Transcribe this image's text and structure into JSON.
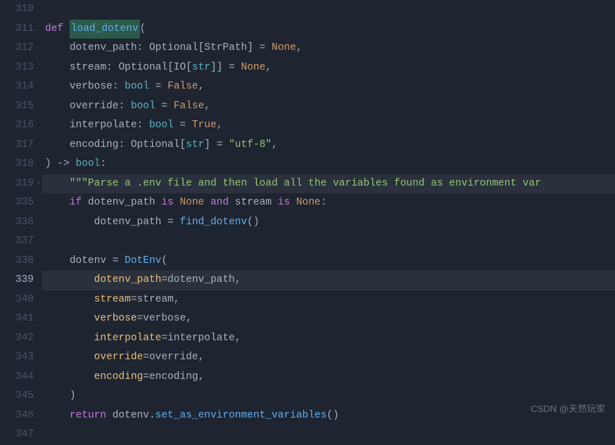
{
  "watermark": "CSDN @天然玩家",
  "gutter": [
    "310",
    "311",
    "312",
    "313",
    "314",
    "315",
    "316",
    "317",
    "318",
    "319",
    "335",
    "336",
    "337",
    "338",
    "339",
    "340",
    "341",
    "342",
    "343",
    "344",
    "345",
    "346",
    "347"
  ],
  "currentLine": "339",
  "foldAt": "319",
  "code": {
    "l311": {
      "def": "def ",
      "fn": "load_dotenv",
      "open": "("
    },
    "l312": {
      "pad": "    ",
      "name": "dotenv_path",
      "colon": ": ",
      "ty": "Optional",
      "br1": "[",
      "ty2": "StrPath",
      "br2": "] ",
      "eq": "= ",
      "val": "None",
      "end": ","
    },
    "l313": {
      "pad": "    ",
      "name": "stream",
      "colon": ": ",
      "ty": "Optional",
      "br1": "[",
      "ty2": "IO",
      "br2": "[",
      "ty3": "str",
      "br3": "]] ",
      "eq": "= ",
      "val": "None",
      "end": ","
    },
    "l314": {
      "pad": "    ",
      "name": "verbose",
      "colon": ": ",
      "ty": "bool",
      "sp": " ",
      "eq": "= ",
      "val": "False",
      "end": ","
    },
    "l315": {
      "pad": "    ",
      "name": "override",
      "colon": ": ",
      "ty": "bool",
      "sp": " ",
      "eq": "= ",
      "val": "False",
      "end": ","
    },
    "l316": {
      "pad": "    ",
      "name": "interpolate",
      "colon": ": ",
      "ty": "bool",
      "sp": " ",
      "eq": "= ",
      "val": "True",
      "end": ","
    },
    "l317": {
      "pad": "    ",
      "name": "encoding",
      "colon": ": ",
      "ty": "Optional",
      "br1": "[",
      "ty2": "str",
      "br2": "] ",
      "eq": "= ",
      "val": "\"utf-8\"",
      "end": ","
    },
    "l318": {
      "close": ") -> ",
      "ty": "bool",
      "colon": ":"
    },
    "l319": {
      "pad": "    ",
      "doc": "\"\"\"Parse a .env file and then load all the variables found as environment var"
    },
    "l335": {
      "pad": "    ",
      "if": "if ",
      "v1": "dotenv_path ",
      "is1": "is ",
      "n1": "None ",
      "and": "and ",
      "v2": "stream ",
      "is2": "is ",
      "n2": "None",
      "colon": ":"
    },
    "l336": {
      "pad": "        ",
      "v": "dotenv_path ",
      "eq": "= ",
      "fn": "find_dotenv",
      "call": "()"
    },
    "l338": {
      "pad": "    ",
      "v": "dotenv ",
      "eq": "= ",
      "cls": "DotEnv",
      "open": "("
    },
    "l339": {
      "pad": "        ",
      "k": "dotenv_path",
      "eq": "=",
      "v": "dotenv_path",
      "end": ","
    },
    "l340": {
      "pad": "        ",
      "k": "stream",
      "eq": "=",
      "v": "stream",
      "end": ","
    },
    "l341": {
      "pad": "        ",
      "k": "verbose",
      "eq": "=",
      "v": "verbose",
      "end": ","
    },
    "l342": {
      "pad": "        ",
      "k": "interpolate",
      "eq": "=",
      "v": "interpolate",
      "end": ","
    },
    "l343": {
      "pad": "        ",
      "k": "override",
      "eq": "=",
      "v": "override",
      "end": ","
    },
    "l344": {
      "pad": "        ",
      "k": "encoding",
      "eq": "=",
      "v": "encoding",
      "end": ","
    },
    "l345": {
      "pad": "    ",
      "close": ")"
    },
    "l346": {
      "pad": "    ",
      "ret": "return ",
      "v": "dotenv",
      "dot": ".",
      "m": "set_as_environment_variables",
      "call": "()"
    }
  }
}
